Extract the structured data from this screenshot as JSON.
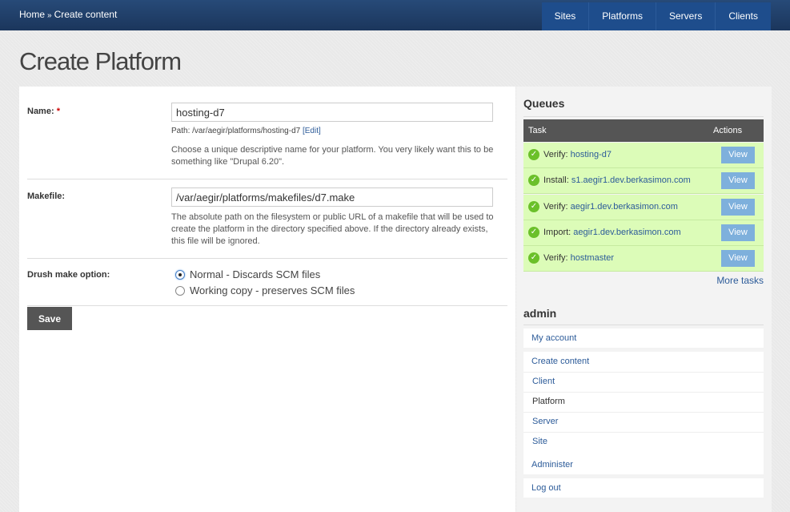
{
  "breadcrumb": [
    "Home",
    "Create content"
  ],
  "breadcrumb_sep": "»",
  "nav": [
    "Sites",
    "Platforms",
    "Servers",
    "Clients"
  ],
  "page_title": "Create Platform",
  "form": {
    "name": {
      "label": "Name:",
      "required": "*",
      "value": "hosting-d7",
      "path_prefix": "Path: /var/aegir/platforms/hosting-d7",
      "edit_link": "[Edit]",
      "description": "Choose a unique descriptive name for your platform. You very likely want this to be something like \"Drupal 6.20\"."
    },
    "makefile": {
      "label": "Makefile:",
      "value": "/var/aegir/platforms/makefiles/d7.make",
      "description": "The absolute path on the filesystem or public URL of a makefile that will be used to create the platform in the directory specified above. If the directory already exists, this file will be ignored."
    },
    "drush": {
      "label": "Drush make option:",
      "options": [
        "Normal - Discards SCM files",
        "Working copy - preserves SCM files"
      ],
      "selected": 0
    },
    "save_label": "Save"
  },
  "queues": {
    "title": "Queues",
    "col_task": "Task",
    "col_actions": "Actions",
    "rows": [
      {
        "action": "Verify:",
        "target": "hosting-d7",
        "button": "View"
      },
      {
        "action": "Install:",
        "target": "s1.aegir1.dev.berkasimon.com",
        "button": "View"
      },
      {
        "action": "Verify:",
        "target": "aegir1.dev.berkasimon.com",
        "button": "View"
      },
      {
        "action": "Import:",
        "target": "aegir1.dev.berkasimon.com",
        "button": "View"
      },
      {
        "action": "Verify:",
        "target": "hostmaster",
        "button": "View"
      }
    ],
    "more": "More tasks",
    "row_color": "#dcfcb8",
    "check_color": "#6bc02a"
  },
  "admin": {
    "title": "admin",
    "my_account": "My account",
    "create_content": "Create content",
    "sub_items": [
      "Client",
      "Platform",
      "Server",
      "Site"
    ],
    "active_sub": "Platform",
    "administer": "Administer",
    "logout": "Log out"
  }
}
